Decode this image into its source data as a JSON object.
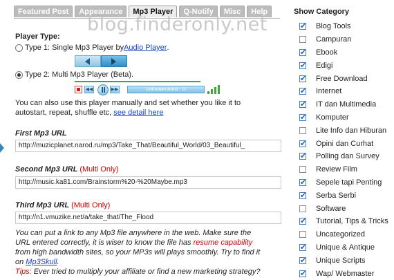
{
  "tabs": [
    "Featured Post",
    "Appearance",
    "Mp3 Player",
    "Q-Notify",
    "Misc",
    "Help"
  ],
  "watermark": "blog.finderonly.net",
  "player_type": {
    "title": "Player Type:",
    "type1_prefix": "Type 1: Single Mp3 Player by ",
    "type1_link": "Audio Player",
    "type1_suffix": ".",
    "type2_label": "Type 2: Multi Mp3 Player (Beta).",
    "selected": "Type 2"
  },
  "player2": {
    "track_text": "Unknown Artist - U",
    "prev_glyph": "◀◀",
    "next_glyph": "▶▶"
  },
  "setup_text": {
    "line1": "You can also use this player manually and set whether you like it to",
    "line2_prefix": "autostart, repeat, shuffle etc, ",
    "line2_link": "see detail here"
  },
  "fields": [
    {
      "label": "First Mp3 URL",
      "multi": "",
      "value": "http://muzicplanet.narod.ru/mp3/Take_That/Beautiful_World/03_Beautiful_"
    },
    {
      "label": "Second Mp3 URL",
      "multi": "(Multi Only)",
      "value": "http://music.ka81.com/Brainstorm%20-%20Maybe.mp3"
    },
    {
      "label": "Third Mp3 URL",
      "multi": "(Multi Only)",
      "value": "http://n1.vmuzike.net/a/take_that/The_Flood"
    }
  ],
  "note": {
    "line1": "You can put a link to any Mp3 file anywhere in the web. Make sure the",
    "line2_prefix": "URL entered correctly, it is wiser to know the file has ",
    "line2_red": "resume capability",
    "line3": "from high bandwidth sites, so your MP3s will plays smoothly. Try to find it",
    "line4_prefix": "on ",
    "line4_link": "Mp3Skull",
    "line4_suffix": ".",
    "tips_label": "Tips:",
    "tips_text": " Ever tried to multiply your affiliate or find a new marketing strategy?"
  },
  "categories": {
    "title": "Show Category",
    "items": [
      {
        "label": "Blog Tools",
        "checked": true
      },
      {
        "label": "Campuran",
        "checked": false
      },
      {
        "label": "Ebook",
        "checked": true
      },
      {
        "label": "Edigi",
        "checked": true
      },
      {
        "label": "Free Download",
        "checked": true
      },
      {
        "label": "Internet",
        "checked": true
      },
      {
        "label": "IT dan Multimedia",
        "checked": true
      },
      {
        "label": "Komputer",
        "checked": true
      },
      {
        "label": "Lite Info dan Hiburan",
        "checked": false
      },
      {
        "label": "Opini dan Curhat",
        "checked": true
      },
      {
        "label": "Polling dan Survey",
        "checked": true
      },
      {
        "label": "Review Film",
        "checked": false
      },
      {
        "label": "Sepele tapi Penting",
        "checked": true
      },
      {
        "label": "Serba Serbi",
        "checked": true
      },
      {
        "label": "Software",
        "checked": false
      },
      {
        "label": "Tutorial, Tips & Tricks",
        "checked": true
      },
      {
        "label": "Uncategorized",
        "checked": false
      },
      {
        "label": "Unique & Antique",
        "checked": true
      },
      {
        "label": "Unique Scripts",
        "checked": true
      },
      {
        "label": "Wap/ Webmaster",
        "checked": true
      }
    ]
  }
}
